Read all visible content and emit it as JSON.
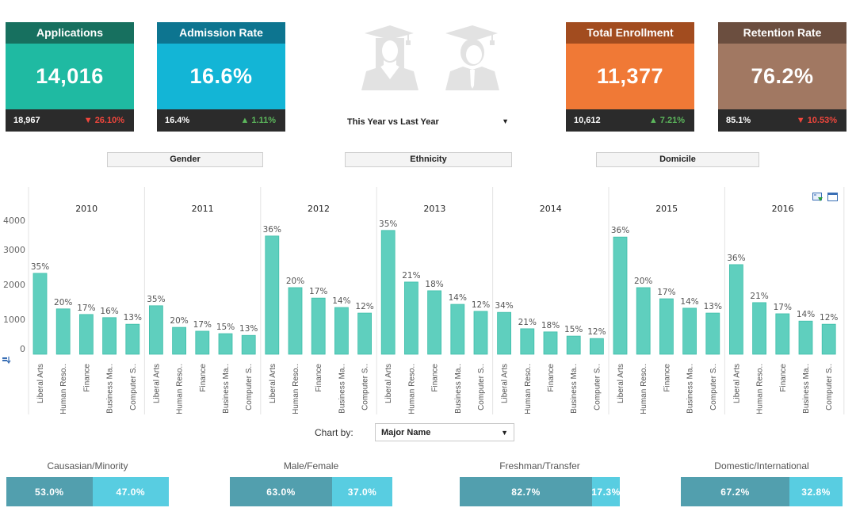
{
  "kpis": {
    "applications": {
      "title": "Applications",
      "value": "14,016",
      "previous": "18,967",
      "change": "26.10%",
      "direction": "down"
    },
    "admission_rate": {
      "title": "Admission Rate",
      "value": "16.6%",
      "previous": "16.4%",
      "change": "1.11%",
      "direction": "up"
    },
    "total_enrollment": {
      "title": "Total Enrollment",
      "value": "11,377",
      "previous": "10,612",
      "change": "7.21%",
      "direction": "up"
    },
    "retention_rate": {
      "title": "Retention Rate",
      "value": "76.2%",
      "previous": "85.1%",
      "change": "10.53%",
      "direction": "down"
    }
  },
  "arrows": {
    "up": "▲",
    "down": "▼"
  },
  "period_select": {
    "value": "This Year vs Last Year",
    "arrow": "▼"
  },
  "segment_buttons": {
    "gender": "Gender",
    "ethnicity": "Ethnicity",
    "domicile": "Domicile"
  },
  "chart_by": {
    "label": "Chart by:",
    "value": "Major Name",
    "arrow": "▼"
  },
  "splits": [
    {
      "title": "Causasian/Minority",
      "a": "53.0%",
      "b": "47.0%",
      "a_frac": 0.53
    },
    {
      "title": "Male/Female",
      "a": "63.0%",
      "b": "37.0%",
      "a_frac": 0.63
    },
    {
      "title": "Freshman/Transfer",
      "a": "82.7%",
      "b": "17.3%",
      "a_frac": 0.827
    },
    {
      "title": "Domestic/International",
      "a": "67.2%",
      "b": "32.8%",
      "a_frac": 0.672
    }
  ],
  "colors": {
    "bar": "#5fcfbe",
    "bar_edge": "#3fbfaa"
  },
  "chart_data": {
    "type": "bar",
    "title": "",
    "xlabel": "",
    "ylabel": "",
    "ylim": [
      0,
      4000
    ],
    "yticks": [
      0,
      1000,
      2000,
      3000,
      4000
    ],
    "grid": false,
    "categories": [
      "Liberal Arts",
      "Human Reso..",
      "Finance",
      "Business Ma..",
      "Computer S.."
    ],
    "panels": [
      {
        "year": "2010",
        "values": [
          2320,
          1300,
          1140,
          1050,
          860
        ],
        "labels": [
          "35%",
          "20%",
          "17%",
          "16%",
          "13%"
        ]
      },
      {
        "year": "2011",
        "values": [
          1390,
          770,
          660,
          590,
          540
        ],
        "labels": [
          "35%",
          "20%",
          "17%",
          "15%",
          "13%"
        ]
      },
      {
        "year": "2012",
        "values": [
          3390,
          1910,
          1610,
          1340,
          1180
        ],
        "labels": [
          "36%",
          "20%",
          "17%",
          "14%",
          "12%"
        ]
      },
      {
        "year": "2013",
        "values": [
          3550,
          2070,
          1820,
          1430,
          1230
        ],
        "labels": [
          "35%",
          "21%",
          "18%",
          "14%",
          "12%"
        ]
      },
      {
        "year": "2014",
        "values": [
          1200,
          730,
          640,
          520,
          450
        ],
        "labels": [
          "34%",
          "21%",
          "18%",
          "15%",
          "12%"
        ]
      },
      {
        "year": "2015",
        "values": [
          3360,
          1910,
          1590,
          1320,
          1180
        ],
        "labels": [
          "36%",
          "20%",
          "17%",
          "14%",
          "13%"
        ]
      },
      {
        "year": "2016",
        "values": [
          2570,
          1480,
          1160,
          950,
          860
        ],
        "labels": [
          "36%",
          "21%",
          "17%",
          "14%",
          "12%"
        ]
      }
    ]
  }
}
